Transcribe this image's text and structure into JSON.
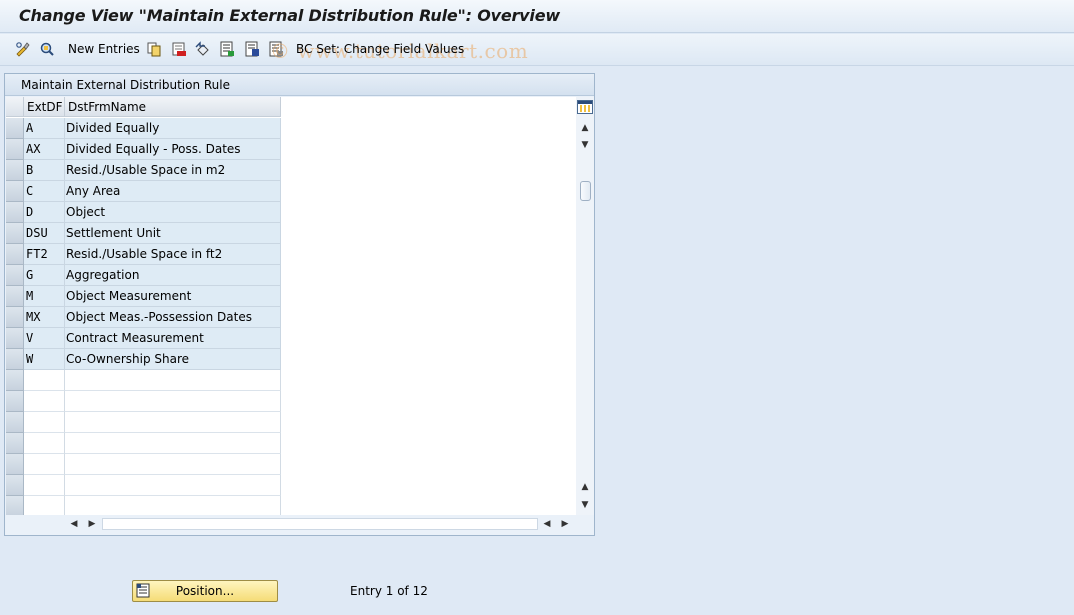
{
  "window": {
    "title": "Change View \"Maintain External Distribution Rule\": Overview"
  },
  "toolbar": {
    "new_entries_label": "New Entries",
    "bc_set_label": "BC Set: Change Field Values",
    "watermark": "© www.tutorialkart.com",
    "icons": [
      "display-change-icon",
      "other-view-icon",
      "copy-icon",
      "delete-icon",
      "undo-icon",
      "select-all-icon",
      "select-block-icon",
      "deselect-all-icon"
    ]
  },
  "table": {
    "panel_title": "Maintain External Distribution Rule",
    "columns": [
      "ExtDF",
      "DstFrmName"
    ],
    "rows": [
      {
        "code": "A",
        "name": "Divided Equally"
      },
      {
        "code": "AX",
        "name": "Divided Equally - Poss. Dates"
      },
      {
        "code": "B",
        "name": "Resid./Usable Space in m2"
      },
      {
        "code": "C",
        "name": "Any Area"
      },
      {
        "code": "D",
        "name": "Object"
      },
      {
        "code": "DSU",
        "name": "Settlement Unit"
      },
      {
        "code": "FT2",
        "name": "Resid./Usable Space in ft2"
      },
      {
        "code": "G",
        "name": "Aggregation"
      },
      {
        "code": "M",
        "name": "Object Measurement"
      },
      {
        "code": "MX",
        "name": "Object Meas.-Possession Dates"
      },
      {
        "code": "V",
        "name": "Contract Measurement"
      },
      {
        "code": "W",
        "name": "Co-Ownership Share"
      }
    ],
    "empty_rows": 7
  },
  "footer": {
    "position_button_label": "Position...",
    "entry_info": "Entry 1 of 12"
  },
  "colors": {
    "background": "#dfe9f5",
    "row_fill": "#deebf5",
    "button_fill": "#f5dc77"
  }
}
